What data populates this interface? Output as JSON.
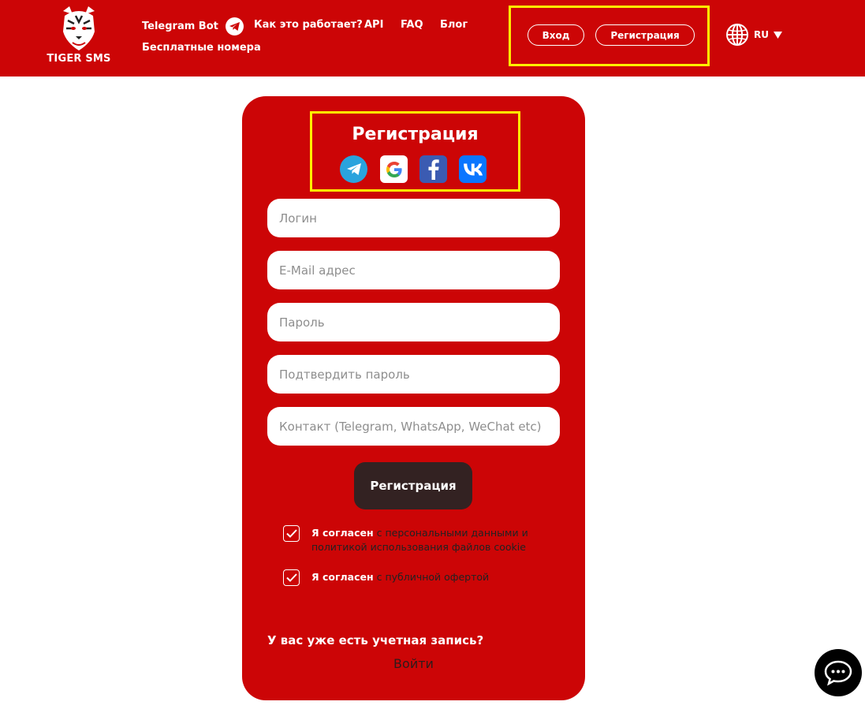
{
  "header": {
    "logo_text": "TIGER SMS",
    "nav": {
      "telegram_bot": "Telegram Bot",
      "how_it_works": "Как это работает?",
      "api": "API",
      "faq": "FAQ",
      "blog": "Блог",
      "free_numbers": "Бесплатные номера"
    },
    "login_label": "Вход",
    "register_label": "Регистрация",
    "language": "RU"
  },
  "form": {
    "title": "Регистрация",
    "social_icons": [
      "telegram-icon",
      "google-icon",
      "facebook-icon",
      "vk-icon"
    ],
    "fields": {
      "login_placeholder": "Логин",
      "email_placeholder": "E-Mail адрес",
      "password_placeholder": "Пароль",
      "confirm_placeholder": "Подтвердить пароль",
      "contact_placeholder": "Контакт (Telegram, WhatsApp, WeChat etc)"
    },
    "submit_label": "Регистрация",
    "consent1": {
      "lead": "Я согласен",
      "text": "с персональными данными и политикой использования файлов cookie",
      "checked": true
    },
    "consent2": {
      "lead": "Я согласен",
      "text": "с публичной офертой",
      "checked": true
    },
    "has_account": "У вас уже есть учетная запись?",
    "login_link": "Войти"
  },
  "colors": {
    "brand_red": "#cc0506",
    "highlight_yellow": "#fff200",
    "button_dark": "#332222"
  },
  "chat_widget_icon": "chat-bubble-icon"
}
